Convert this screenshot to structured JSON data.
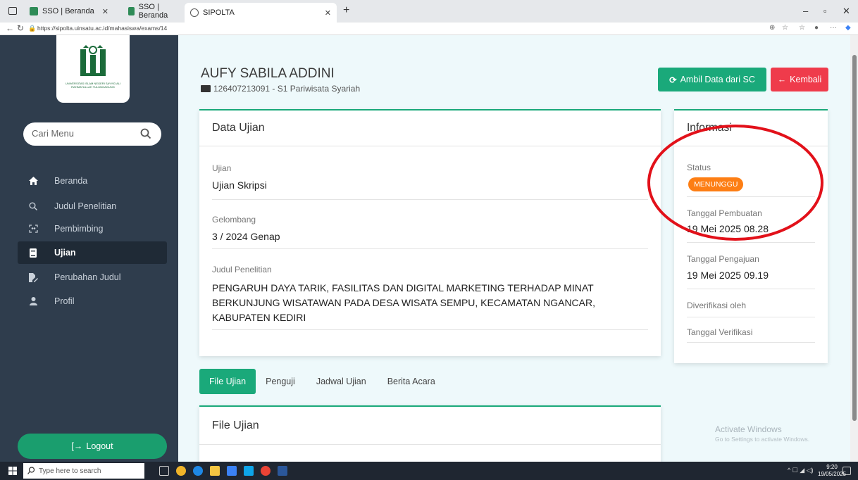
{
  "browser": {
    "tabs": [
      {
        "label": "SSO | Beranda",
        "active": false
      },
      {
        "label": "SSO | Beranda",
        "active": false
      },
      {
        "label": "SIPOLTA",
        "active": true
      }
    ],
    "url": "https://sipolta.uinsatu.ac.id/mahasiswa/exams/14"
  },
  "sidebar": {
    "logo_text": "UNIVERSITAS ISLAM NEGERI SAYYID ALI RAHMATULLAH TULUNGAGUNG",
    "search_placeholder": "Cari Menu",
    "items": [
      {
        "label": "Beranda",
        "icon": "home-icon",
        "active": false
      },
      {
        "label": "Judul Penelitian",
        "icon": "search-icon",
        "active": false
      },
      {
        "label": "Pembimbing",
        "icon": "people-icon",
        "active": false
      },
      {
        "label": "Ujian",
        "icon": "book-icon",
        "active": true
      },
      {
        "label": "Perubahan Judul",
        "icon": "edit-file-icon",
        "active": false
      },
      {
        "label": "Profil",
        "icon": "user-icon",
        "active": false
      }
    ],
    "logout_label": "Logout"
  },
  "header": {
    "name": "AUFY SABILA ADDINI",
    "subtitle": "126407213091 - S1 Pariwisata Syariah",
    "btn_sync": "Ambil Data dari SC",
    "btn_back": "Kembali"
  },
  "exam": {
    "title": "Data Ujian",
    "ujian_label": "Ujian",
    "ujian_value": "Ujian Skripsi",
    "gelombang_label": "Gelombang",
    "gelombang_value": "3 / 2024 Genap",
    "judul_label": "Judul Penelitian",
    "judul_value": "PENGARUH DAYA TARIK, FASILITAS DAN DIGITAL MARKETING TERHADAP MINAT BERKUNJUNG WISATAWAN PADA DESA WISATA SEMPU, KECAMATAN NGANCAR, KABUPATEN KEDIRI"
  },
  "info": {
    "title": "Informasi",
    "status_label": "Status",
    "status_value": "MENUNGGU",
    "created_label": "Tanggal Pembuatan",
    "created_value": "19 Mei 2025 08.28",
    "submitted_label": "Tanggal Pengajuan",
    "submitted_value": "19 Mei 2025 09.19",
    "verified_by_label": "Diverifikasi oleh",
    "verified_date_label": "Tanggal Verifikasi"
  },
  "tabs": [
    "File Ujian",
    "Penguji",
    "Jadwal Ujian",
    "Berita Acara"
  ],
  "file_panel": {
    "title": "File Ujian"
  },
  "watermark": {
    "line1": "Activate Windows",
    "line2": "Go to Settings to activate Windows."
  },
  "taskbar": {
    "search_placeholder": "Type here to search",
    "time": "9:20",
    "date": "19/05/2025"
  },
  "colors": {
    "sidebar_bg": "#2f3d4d",
    "accent_green": "#1aa97a",
    "danger_red": "#ef3b4b",
    "status_orange": "#fd7e14",
    "annotation_red": "#e2111a"
  }
}
